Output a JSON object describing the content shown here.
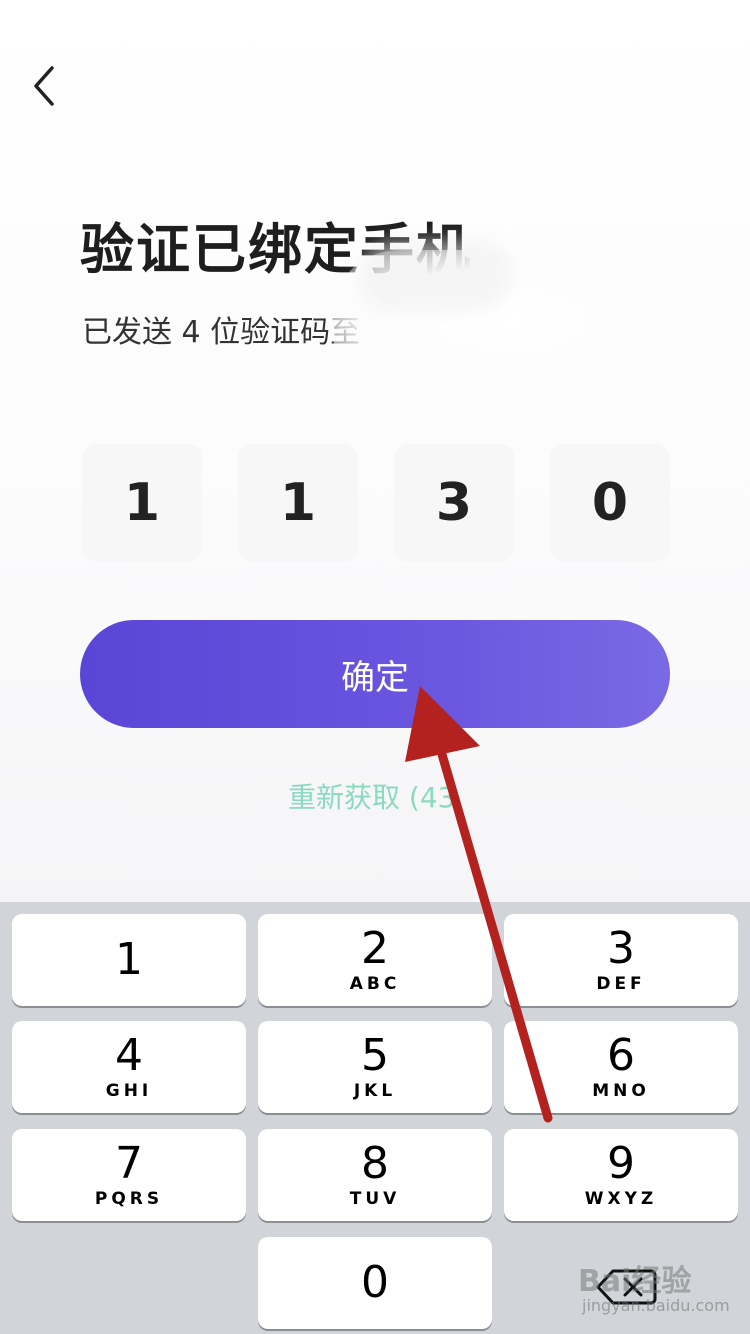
{
  "header": {
    "title": "验证已绑定手机",
    "subtitle": "已发送 4 位验证码至"
  },
  "code": {
    "digits": [
      "1",
      "1",
      "3",
      "0"
    ]
  },
  "actions": {
    "confirm_label": "确定",
    "resend_label": "重新获取 (43"
  },
  "keypad": {
    "keys": [
      {
        "digit": "1",
        "letters": ""
      },
      {
        "digit": "2",
        "letters": "ABC"
      },
      {
        "digit": "3",
        "letters": "DEF"
      },
      {
        "digit": "4",
        "letters": "GHI"
      },
      {
        "digit": "5",
        "letters": "JKL"
      },
      {
        "digit": "6",
        "letters": "MNO"
      },
      {
        "digit": "7",
        "letters": "PQRS"
      },
      {
        "digit": "8",
        "letters": "TUV"
      },
      {
        "digit": "9",
        "letters": "WXYZ"
      },
      {
        "digit": "0",
        "letters": ""
      }
    ]
  },
  "watermark": {
    "brand": "Bai经验",
    "url": "jingyan.baidu.com"
  },
  "colors": {
    "accent": "#5a45d6",
    "resend": "#8ad9c1",
    "arrow": "#b3221e",
    "keyboard_bg": "#d1d4d9"
  },
  "icons": {
    "back": "chevron-left-icon",
    "delete": "backspace-icon"
  }
}
